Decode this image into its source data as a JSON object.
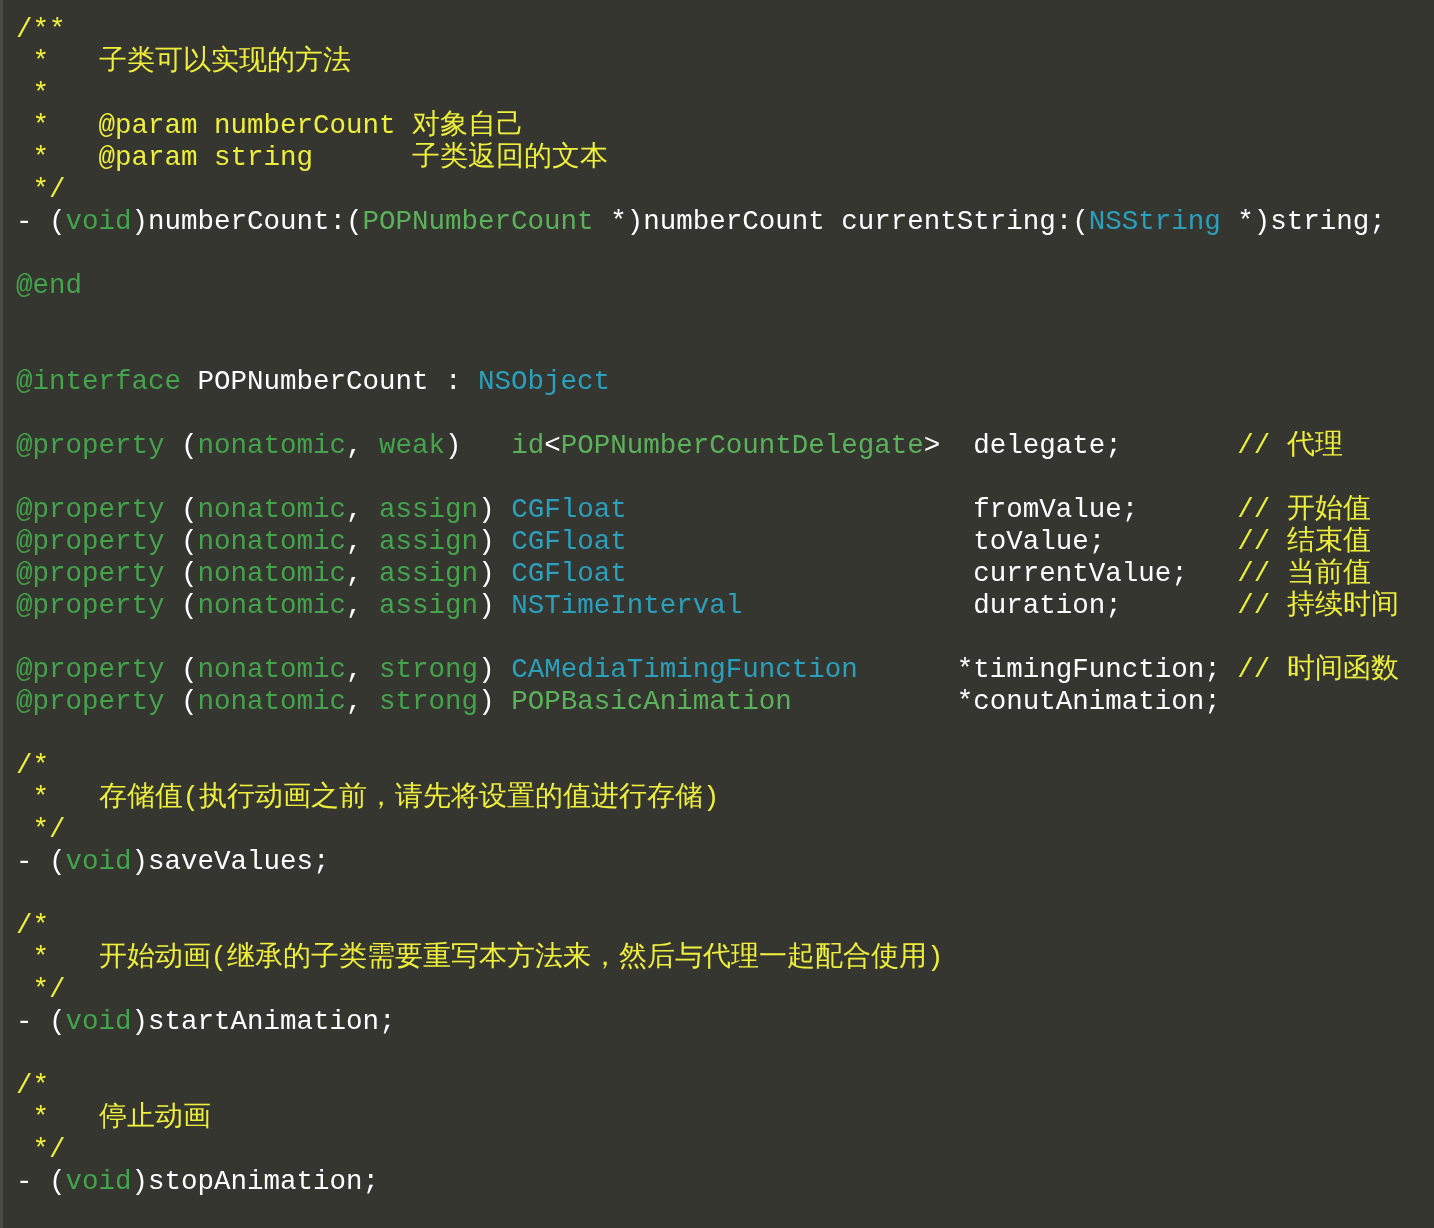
{
  "editor": {
    "lines": [
      {
        "kind": "code",
        "tokens": [
          {
            "kind": "comment",
            "text": "/**"
          }
        ]
      },
      {
        "kind": "code",
        "tokens": [
          {
            "kind": "comment",
            "text": " *   子类可以实现的方法"
          }
        ]
      },
      {
        "kind": "code",
        "tokens": [
          {
            "kind": "comment",
            "text": " *"
          }
        ]
      },
      {
        "kind": "code",
        "tokens": [
          {
            "kind": "comment",
            "text": " *   @param numberCount 对象自己"
          }
        ]
      },
      {
        "kind": "code",
        "tokens": [
          {
            "kind": "comment",
            "text": " *   @param string      子类返回的文本"
          }
        ]
      },
      {
        "kind": "code",
        "tokens": [
          {
            "kind": "comment",
            "text": " */"
          }
        ]
      },
      {
        "kind": "code",
        "tokens": [
          {
            "kind": "plain",
            "text": "- ("
          },
          {
            "kind": "keyword",
            "text": "void"
          },
          {
            "kind": "plain",
            "text": ")numberCount:("
          },
          {
            "kind": "class",
            "text": "POPNumberCount"
          },
          {
            "kind": "plain",
            "text": " *)numberCount currentString:("
          },
          {
            "kind": "type",
            "text": "NSString"
          },
          {
            "kind": "plain",
            "text": " *)string;"
          }
        ]
      },
      {
        "kind": "blank"
      },
      {
        "kind": "code",
        "tokens": [
          {
            "kind": "keyword",
            "text": "@end"
          }
        ]
      },
      {
        "kind": "blank"
      },
      {
        "kind": "blank"
      },
      {
        "kind": "code",
        "tokens": [
          {
            "kind": "keyword",
            "text": "@interface"
          },
          {
            "kind": "plain",
            "text": " POPNumberCount : "
          },
          {
            "kind": "type",
            "text": "NSObject"
          }
        ]
      },
      {
        "kind": "blank"
      },
      {
        "kind": "code",
        "tokens": [
          {
            "kind": "keyword",
            "text": "@property"
          },
          {
            "kind": "plain",
            "text": " ("
          },
          {
            "kind": "keyword",
            "text": "nonatomic"
          },
          {
            "kind": "plain",
            "text": ", "
          },
          {
            "kind": "keyword",
            "text": "weak"
          },
          {
            "kind": "plain",
            "text": ")   "
          },
          {
            "kind": "class",
            "text": "id"
          },
          {
            "kind": "plain",
            "text": "<"
          },
          {
            "kind": "class",
            "text": "POPNumberCountDelegate"
          },
          {
            "kind": "plain",
            "text": ">  delegate;       "
          },
          {
            "kind": "comment",
            "text": "// 代理"
          }
        ]
      },
      {
        "kind": "blank"
      },
      {
        "kind": "code",
        "tokens": [
          {
            "kind": "keyword",
            "text": "@property"
          },
          {
            "kind": "plain",
            "text": " ("
          },
          {
            "kind": "keyword",
            "text": "nonatomic"
          },
          {
            "kind": "plain",
            "text": ", "
          },
          {
            "kind": "keyword",
            "text": "assign"
          },
          {
            "kind": "plain",
            "text": ") "
          },
          {
            "kind": "type",
            "text": "CGFloat"
          },
          {
            "kind": "plain",
            "text": "                     fromValue;      "
          },
          {
            "kind": "comment",
            "text": "// 开始值"
          }
        ]
      },
      {
        "kind": "code",
        "tokens": [
          {
            "kind": "keyword",
            "text": "@property"
          },
          {
            "kind": "plain",
            "text": " ("
          },
          {
            "kind": "keyword",
            "text": "nonatomic"
          },
          {
            "kind": "plain",
            "text": ", "
          },
          {
            "kind": "keyword",
            "text": "assign"
          },
          {
            "kind": "plain",
            "text": ") "
          },
          {
            "kind": "type",
            "text": "CGFloat"
          },
          {
            "kind": "plain",
            "text": "                     toValue;        "
          },
          {
            "kind": "comment",
            "text": "// 结束值"
          }
        ]
      },
      {
        "kind": "code",
        "tokens": [
          {
            "kind": "keyword",
            "text": "@property"
          },
          {
            "kind": "plain",
            "text": " ("
          },
          {
            "kind": "keyword",
            "text": "nonatomic"
          },
          {
            "kind": "plain",
            "text": ", "
          },
          {
            "kind": "keyword",
            "text": "assign"
          },
          {
            "kind": "plain",
            "text": ") "
          },
          {
            "kind": "type",
            "text": "CGFloat"
          },
          {
            "kind": "plain",
            "text": "                     currentValue;   "
          },
          {
            "kind": "comment",
            "text": "// 当前值"
          }
        ]
      },
      {
        "kind": "code",
        "tokens": [
          {
            "kind": "keyword",
            "text": "@property"
          },
          {
            "kind": "plain",
            "text": " ("
          },
          {
            "kind": "keyword",
            "text": "nonatomic"
          },
          {
            "kind": "plain",
            "text": ", "
          },
          {
            "kind": "keyword",
            "text": "assign"
          },
          {
            "kind": "plain",
            "text": ") "
          },
          {
            "kind": "type",
            "text": "NSTimeInterval"
          },
          {
            "kind": "plain",
            "text": "              duration;       "
          },
          {
            "kind": "comment",
            "text": "// 持续时间"
          }
        ]
      },
      {
        "kind": "blank"
      },
      {
        "kind": "code",
        "tokens": [
          {
            "kind": "keyword",
            "text": "@property"
          },
          {
            "kind": "plain",
            "text": " ("
          },
          {
            "kind": "keyword",
            "text": "nonatomic"
          },
          {
            "kind": "plain",
            "text": ", "
          },
          {
            "kind": "keyword",
            "text": "strong"
          },
          {
            "kind": "plain",
            "text": ") "
          },
          {
            "kind": "type",
            "text": "CAMediaTimingFunction"
          },
          {
            "kind": "plain",
            "text": "      *timingFunction; "
          },
          {
            "kind": "comment",
            "text": "// 时间函数"
          }
        ]
      },
      {
        "kind": "code",
        "tokens": [
          {
            "kind": "keyword",
            "text": "@property"
          },
          {
            "kind": "plain",
            "text": " ("
          },
          {
            "kind": "keyword",
            "text": "nonatomic"
          },
          {
            "kind": "plain",
            "text": ", "
          },
          {
            "kind": "keyword",
            "text": "strong"
          },
          {
            "kind": "plain",
            "text": ") "
          },
          {
            "kind": "class",
            "text": "POPBasicAnimation"
          },
          {
            "kind": "plain",
            "text": "          *conutAnimation;"
          }
        ]
      },
      {
        "kind": "blank"
      },
      {
        "kind": "code",
        "tokens": [
          {
            "kind": "comment",
            "text": "/*"
          }
        ]
      },
      {
        "kind": "code",
        "tokens": [
          {
            "kind": "comment",
            "text": " *   存储值(执行动画之前，请先将设置的值进行存储)"
          }
        ]
      },
      {
        "kind": "code",
        "tokens": [
          {
            "kind": "comment",
            "text": " */"
          }
        ]
      },
      {
        "kind": "code",
        "tokens": [
          {
            "kind": "plain",
            "text": "- ("
          },
          {
            "kind": "keyword",
            "text": "void"
          },
          {
            "kind": "plain",
            "text": ")saveValues;"
          }
        ]
      },
      {
        "kind": "blank"
      },
      {
        "kind": "code",
        "tokens": [
          {
            "kind": "comment",
            "text": "/*"
          }
        ]
      },
      {
        "kind": "code",
        "tokens": [
          {
            "kind": "comment",
            "text": " *   开始动画(继承的子类需要重写本方法来，然后与代理一起配合使用)"
          }
        ]
      },
      {
        "kind": "code",
        "tokens": [
          {
            "kind": "comment",
            "text": " */"
          }
        ]
      },
      {
        "kind": "code",
        "tokens": [
          {
            "kind": "plain",
            "text": "- ("
          },
          {
            "kind": "keyword",
            "text": "void"
          },
          {
            "kind": "plain",
            "text": ")startAnimation;"
          }
        ]
      },
      {
        "kind": "blank"
      },
      {
        "kind": "code",
        "tokens": [
          {
            "kind": "comment",
            "text": "/*"
          }
        ]
      },
      {
        "kind": "code",
        "tokens": [
          {
            "kind": "comment",
            "text": " *   停止动画"
          }
        ]
      },
      {
        "kind": "code",
        "tokens": [
          {
            "kind": "comment",
            "text": " */"
          }
        ]
      },
      {
        "kind": "code",
        "tokens": [
          {
            "kind": "plain",
            "text": "- ("
          },
          {
            "kind": "keyword",
            "text": "void"
          },
          {
            "kind": "plain",
            "text": ")stopAnimation;"
          }
        ]
      }
    ]
  }
}
